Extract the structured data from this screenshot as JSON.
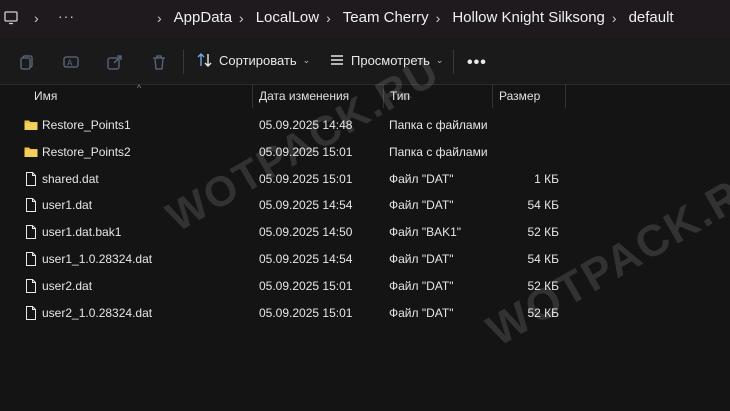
{
  "address_bar": {
    "ellipsis": "···",
    "crumbs": [
      "AppData",
      "LocalLow",
      "Team Cherry",
      "Hollow Knight Silksong",
      "default"
    ]
  },
  "toolbar": {
    "sort_label": "Сортировать",
    "view_label": "Просмотреть",
    "more_label": "•••"
  },
  "columns": {
    "name": "Имя",
    "date": "Дата изменения",
    "type": "Тип",
    "size": "Размер"
  },
  "files": [
    {
      "name": "Restore_Points1",
      "date": "05.09.2025 14:48",
      "type": "Папка с файлами",
      "size": "",
      "kind": "folder"
    },
    {
      "name": "Restore_Points2",
      "date": "05.09.2025 15:01",
      "type": "Папка с файлами",
      "size": "",
      "kind": "folder"
    },
    {
      "name": "shared.dat",
      "date": "05.09.2025 15:01",
      "type": "Файл \"DAT\"",
      "size": "1 КБ",
      "kind": "file"
    },
    {
      "name": "user1.dat",
      "date": "05.09.2025 14:54",
      "type": "Файл \"DAT\"",
      "size": "54 КБ",
      "kind": "file"
    },
    {
      "name": "user1.dat.bak1",
      "date": "05.09.2025 14:50",
      "type": "Файл \"BAK1\"",
      "size": "52 КБ",
      "kind": "file"
    },
    {
      "name": "user1_1.0.28324.dat",
      "date": "05.09.2025 14:54",
      "type": "Файл \"DAT\"",
      "size": "54 КБ",
      "kind": "file"
    },
    {
      "name": "user2.dat",
      "date": "05.09.2025 15:01",
      "type": "Файл \"DAT\"",
      "size": "52 КБ",
      "kind": "file"
    },
    {
      "name": "user2_1.0.28324.dat",
      "date": "05.09.2025 15:01",
      "type": "Файл \"DAT\"",
      "size": "52 КБ",
      "kind": "file"
    }
  ],
  "watermark": "WOTPACK.RU",
  "colors": {
    "folder": "#f0c040",
    "background": "#141414",
    "addressbar": "#1e1a1e"
  }
}
